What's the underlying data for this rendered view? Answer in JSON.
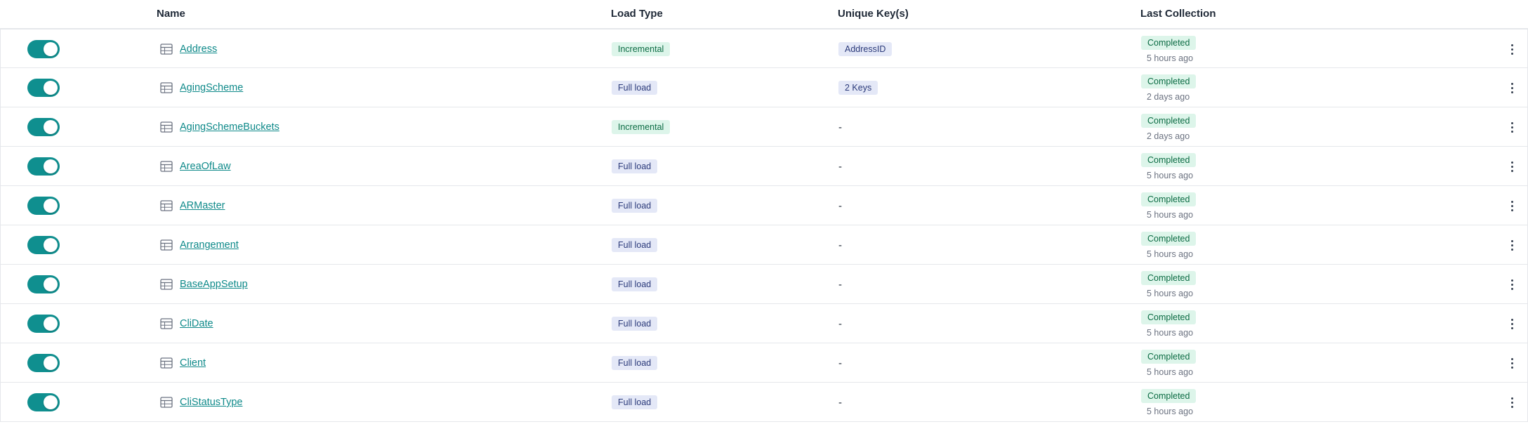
{
  "header": {
    "name": "Name",
    "load_type": "Load Type",
    "unique_keys": "Unique Key(s)",
    "last_collection": "Last Collection"
  },
  "colors": {
    "accent": "#0f8f8f",
    "link": "#0f8a8a",
    "incremental_bg": "#ddf5ea",
    "full_load_bg": "#e4e8f7"
  },
  "rows": [
    {
      "enabled": true,
      "name": "Address",
      "load_type": "Incremental",
      "load_kind": "incremental",
      "unique_key": "AddressID",
      "has_key": true,
      "status": "Completed",
      "ago": "5 hours ago"
    },
    {
      "enabled": true,
      "name": "AgingScheme",
      "load_type": "Full load",
      "load_kind": "full",
      "unique_key": "2 Keys",
      "has_key": true,
      "status": "Completed",
      "ago": "2 days ago"
    },
    {
      "enabled": true,
      "name": "AgingSchemeBuckets",
      "load_type": "Incremental",
      "load_kind": "incremental",
      "unique_key": "-",
      "has_key": false,
      "status": "Completed",
      "ago": "2 days ago"
    },
    {
      "enabled": true,
      "name": "AreaOfLaw",
      "load_type": "Full load",
      "load_kind": "full",
      "unique_key": "-",
      "has_key": false,
      "status": "Completed",
      "ago": "5 hours ago"
    },
    {
      "enabled": true,
      "name": "ARMaster",
      "load_type": "Full load",
      "load_kind": "full",
      "unique_key": "-",
      "has_key": false,
      "status": "Completed",
      "ago": "5 hours ago"
    },
    {
      "enabled": true,
      "name": "Arrangement",
      "load_type": "Full load",
      "load_kind": "full",
      "unique_key": "-",
      "has_key": false,
      "status": "Completed",
      "ago": "5 hours ago"
    },
    {
      "enabled": true,
      "name": "BaseAppSetup",
      "load_type": "Full load",
      "load_kind": "full",
      "unique_key": "-",
      "has_key": false,
      "status": "Completed",
      "ago": "5 hours ago"
    },
    {
      "enabled": true,
      "name": "CliDate",
      "load_type": "Full load",
      "load_kind": "full",
      "unique_key": "-",
      "has_key": false,
      "status": "Completed",
      "ago": "5 hours ago"
    },
    {
      "enabled": true,
      "name": "Client",
      "load_type": "Full load",
      "load_kind": "full",
      "unique_key": "-",
      "has_key": false,
      "status": "Completed",
      "ago": "5 hours ago"
    },
    {
      "enabled": true,
      "name": "CliStatusType",
      "load_type": "Full load",
      "load_kind": "full",
      "unique_key": "-",
      "has_key": false,
      "status": "Completed",
      "ago": "5 hours ago"
    }
  ]
}
